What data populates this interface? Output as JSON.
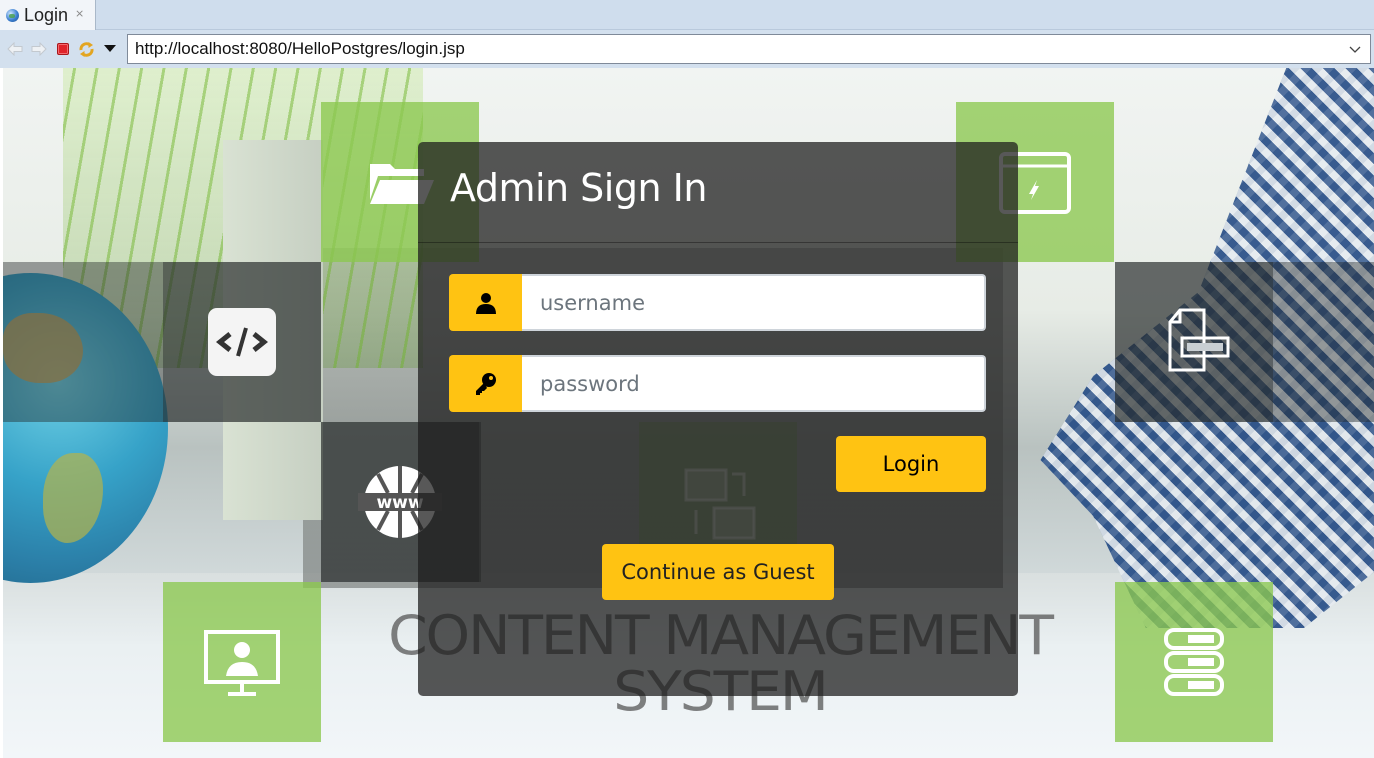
{
  "browser": {
    "tab": {
      "title": "Login",
      "icon": "globe-icon",
      "close_icon": "close-icon"
    },
    "toolbar": {
      "back_icon": "arrow-left-icon",
      "forward_icon": "arrow-right-icon",
      "stop_icon": "stop-icon",
      "refresh_icon": "refresh-icon",
      "menu_icon": "triangle-down-icon"
    },
    "address_bar": {
      "value": "http://localhost:8080/HelloPostgres/login.jsp",
      "dropdown_icon": "chevron-down-icon"
    }
  },
  "background": {
    "tagline_line1": "CONTENT MANAGEMENT",
    "tagline_line2": "SYSTEM",
    "tile_icons": [
      "folder-icon",
      "browser-window-icon",
      "code-icon",
      "document-icon",
      "www-globe-icon",
      "network-icon",
      "monitor-user-icon",
      "server-icon"
    ]
  },
  "login_card": {
    "title": "Admin Sign In",
    "username": {
      "placeholder": "username",
      "value": "",
      "icon": "user-icon"
    },
    "password": {
      "placeholder": "password",
      "value": "",
      "icon": "key-icon"
    },
    "login_button": "Login",
    "guest_button": "Continue as Guest"
  },
  "colors": {
    "accent": "#ffc312",
    "card_background": "rgba(30,30,30,0.74)",
    "tile_green": "#8cc850",
    "tab_bar": "#cfdded"
  }
}
